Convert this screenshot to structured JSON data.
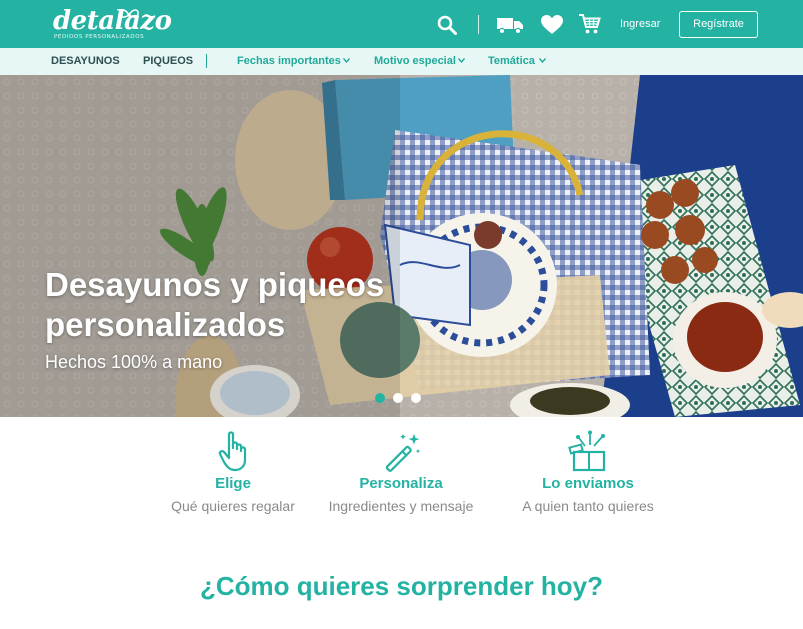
{
  "header": {
    "logo_text": "detalazo",
    "logo_tagline": "PEDIDOS PERSONALIZADOS",
    "login_label": "Ingresar",
    "register_label": "Regístrate",
    "icons": [
      "search-icon",
      "truck-icon",
      "heart-icon",
      "cart-icon"
    ]
  },
  "nav": {
    "items": [
      {
        "label": "DESAYUNOS"
      },
      {
        "label": "PIQUEOS"
      },
      {
        "label": "Fechas importantes"
      },
      {
        "label": "Motivo especial"
      },
      {
        "label": "Temática"
      }
    ]
  },
  "hero": {
    "title": "Desayunos y piqueos personalizados",
    "subtitle": "Hechos 100% a mano",
    "slides": 3,
    "active_slide": 1
  },
  "steps": [
    {
      "icon": "hand-pointer-icon",
      "title": "Elige",
      "desc": "Qué quieres regalar"
    },
    {
      "icon": "magic-wand-icon",
      "title": "Personaliza",
      "desc": "Ingredientes y mensaje"
    },
    {
      "icon": "gift-icon",
      "title": "Lo enviamos",
      "desc": "A quien tanto quieres"
    }
  ],
  "section": {
    "title": "¿Cómo quieres sorprender hoy?"
  },
  "colors": {
    "brand": "#24b3a3",
    "nav_bg": "#e6f7f5",
    "nav_dark": "#2c4f53",
    "muted_text": "#8a8a8a"
  }
}
